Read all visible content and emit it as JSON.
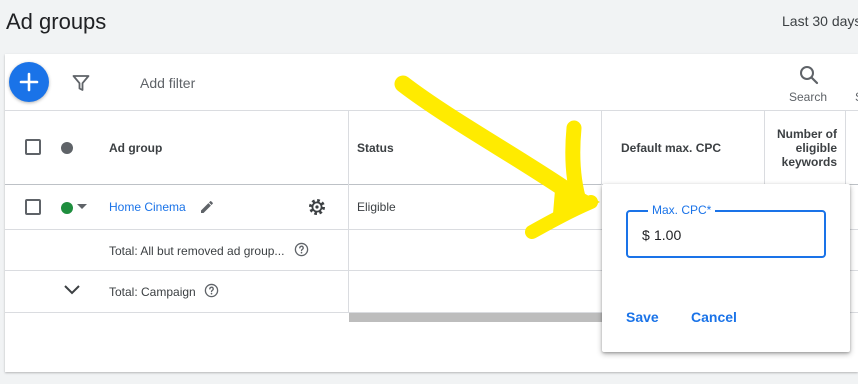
{
  "page": {
    "title": "Ad groups",
    "date_range": "Last 30 days"
  },
  "toolbar": {
    "add_button_icon": "plus-icon",
    "filter_icon": "filter-icon",
    "add_filter_label": "Add filter",
    "search_label": "Search",
    "search_icon": "search-icon",
    "extra_label": "S"
  },
  "table": {
    "headers": {
      "ad_group": "Ad group",
      "status": "Status",
      "default_max_cpc": "Default max. CPC",
      "eligible_keywords": [
        "Number of",
        "eligible",
        "keywords"
      ]
    },
    "rows": [
      {
        "name": "Home Cinema",
        "status": "Eligible",
        "status_color": "#1e8e3e"
      }
    ],
    "totals": [
      {
        "label": "Total: All but removed ad group..."
      },
      {
        "label": "Total: Campaign"
      }
    ]
  },
  "popup": {
    "field_label": "Max. CPC*",
    "currency_prefix": "$",
    "value": "1.00",
    "save_label": "Save",
    "cancel_label": "Cancel"
  },
  "colors": {
    "accent": "#1a73e8",
    "highlight_arrow": "#ffeb00",
    "eligible": "#1e8e3e"
  }
}
